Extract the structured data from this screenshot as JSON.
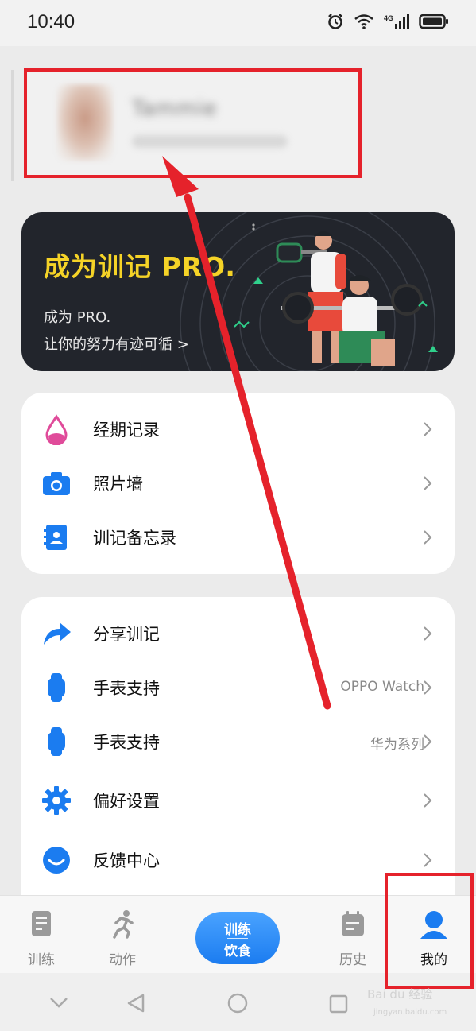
{
  "status_bar": {
    "time": "10:40",
    "network": "4G"
  },
  "profile": {
    "name": "Tammie"
  },
  "pro_banner": {
    "title": "成为训记 PRO.",
    "subtitle_line1": "成为 PRO.",
    "subtitle_line2": "让你的努力有迹可循 >"
  },
  "menu_group1": [
    {
      "label": "经期记录",
      "icon": "drop-icon",
      "value": ""
    },
    {
      "label": "照片墙",
      "icon": "camera-icon",
      "value": ""
    },
    {
      "label": "训记备忘录",
      "icon": "memo-icon",
      "value": ""
    }
  ],
  "menu_group2": [
    {
      "label": "分享训记",
      "icon": "share-icon",
      "value": ""
    },
    {
      "label": "手表支持",
      "icon": "watch-icon",
      "value": "OPPO Watch"
    },
    {
      "label": "手表支持",
      "icon": "watch-icon",
      "value": "华为系列"
    },
    {
      "label": "偏好设置",
      "icon": "gear-icon",
      "value": ""
    },
    {
      "label": "反馈中心",
      "icon": "smile-icon",
      "value": ""
    }
  ],
  "tabbar": {
    "train": "训练",
    "action": "动作",
    "center_line1": "训练",
    "center_line2": "饮食",
    "history": "历史",
    "mine": "我的"
  },
  "colors": {
    "accent": "#1b7cf0",
    "pro_yellow": "#f5d327",
    "banner_bg": "#22252c",
    "annotation_red": "#e5222b"
  },
  "watermark": {
    "brand": "Bai du 经验",
    "url": "jingyan.baidu.com"
  }
}
